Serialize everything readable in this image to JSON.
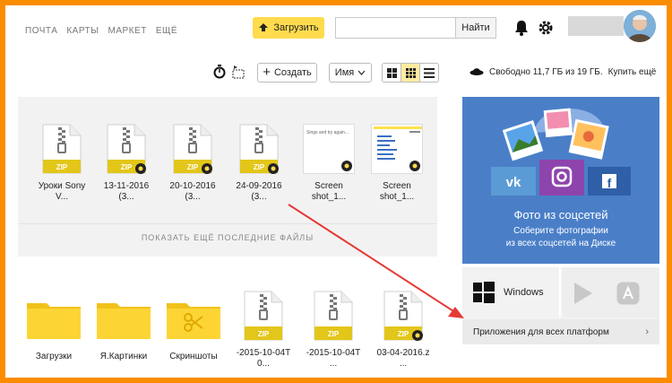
{
  "nav": {
    "items": [
      "ПОЧТА",
      "КАРТЫ",
      "МАРКЕТ",
      "ЕЩЁ"
    ]
  },
  "header": {
    "upload_label": "Загрузить",
    "search_value": "",
    "search_button": "Найти"
  },
  "toolbar": {
    "create_label": "Создать",
    "sort_label": "Имя"
  },
  "storage": {
    "text": "Свободно 11,7 ГБ из 19 ГБ.",
    "buy_label": "Купить ещё"
  },
  "recent": {
    "items": [
      {
        "name": "Уроки Sony",
        "name2": "V...",
        "type": "zip",
        "icon": "zip-file-icon"
      },
      {
        "name": "13-11-2016",
        "name2": "(3...",
        "type": "zip",
        "icon": "zip-file-icon"
      },
      {
        "name": "20-10-2016",
        "name2": "(3...",
        "type": "zip",
        "icon": "zip-file-icon"
      },
      {
        "name": "24-09-2016",
        "name2": "(3...",
        "type": "zip",
        "icon": "zip-file-icon"
      },
      {
        "name": "Screen",
        "name2": "shot_1...",
        "type": "image",
        "icon": "screenshot-thumbnail"
      },
      {
        "name": "Screen",
        "name2": "shot_1...",
        "type": "image",
        "icon": "screenshot-thumbnail"
      }
    ],
    "thumb_text": "Sings and try again...",
    "more_label": "ПОКАЗАТЬ ЕЩЁ ПОСЛЕДНИЕ ФАЙЛЫ"
  },
  "files": {
    "items": [
      {
        "name": "Загрузки",
        "name2": "",
        "type": "folder"
      },
      {
        "name": "Я.Картинки",
        "name2": "",
        "type": "folder"
      },
      {
        "name": "Скриншоты",
        "name2": "",
        "type": "folder-scissors"
      },
      {
        "name": "-2015-10-04T",
        "name2": "0...",
        "type": "zip"
      },
      {
        "name": "-2015-10-04T",
        "name2": "...",
        "type": "zip"
      },
      {
        "name": "03-04-2016.z",
        "name2": "...",
        "type": "zip"
      }
    ]
  },
  "zip_label": "ZIP",
  "promo": {
    "title": "Фото из соцсетей",
    "subtitle_1": "Соберите фотографии",
    "subtitle_2": "из всех соцсетей на Диске"
  },
  "apps": {
    "windows_label": "Windows",
    "link_label": "Приложения для всех платформ"
  },
  "colors": {
    "accent": "#ffdb4d",
    "frame": "#fb8c00",
    "promo_bg": "#4a7fc8",
    "arrow": "#e53935"
  }
}
